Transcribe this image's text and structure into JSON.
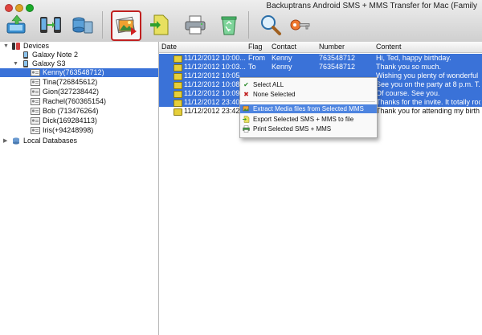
{
  "window": {
    "title": "Backuptrans Android SMS + MMS Transfer for Mac (Family"
  },
  "toolbar": {
    "buttons": [
      {
        "icon": "backup-to-computer-icon"
      },
      {
        "icon": "transfer-between-phones-icon"
      },
      {
        "icon": "restore-database-icon"
      },
      {
        "icon": "extract-media-icon",
        "selected": true
      },
      {
        "icon": "export-file-icon"
      },
      {
        "icon": "print-icon"
      },
      {
        "icon": "recycle-bin-icon"
      },
      {
        "icon": "search-icon"
      },
      {
        "icon": "key-icon"
      }
    ]
  },
  "sidebar": {
    "devices_label": "Devices",
    "device1": "Galaxy Note 2",
    "device2": "Galaxy S3",
    "contacts": [
      "Kenny(763548712)",
      "Tina(726845612)",
      "Gion(327238442)",
      "Rachel(760365154)",
      "Bob (713476264)",
      "Dick(169284113)",
      "Iris(+94248998)"
    ],
    "local_label": "Local Databases"
  },
  "table": {
    "headers": {
      "date": "Date",
      "flag": "Flag",
      "contact": "Contact",
      "number": "Number",
      "content": "Content"
    },
    "rows": [
      {
        "date": "11/12/2012 10:00...",
        "flag": "From",
        "contact": "Kenny",
        "number": "763548712",
        "content": "Hi, Ted, happy birthday."
      },
      {
        "date": "11/12/2012 10:03...",
        "flag": "To",
        "contact": "Kenny",
        "number": "763548712",
        "content": "Thank you so much."
      },
      {
        "date": "11/12/2012 10:05",
        "flag": "",
        "contact": "",
        "number": "",
        "content": "Wishing you plenty of wonderful ..."
      },
      {
        "date": "11/12/2012 10:08",
        "flag": "",
        "contact": "",
        "number": "",
        "content": "See you on the party at 8 p.m. T..."
      },
      {
        "date": "11/12/2012 10:09",
        "flag": "",
        "contact": "",
        "number": "",
        "content": "Of course. See you."
      },
      {
        "date": "11/12/2012 23:40",
        "flag": "",
        "contact": "",
        "number": "",
        "content": "Thanks for the invite. It totally roc..."
      },
      {
        "date": "11/12/2012 23:42",
        "flag": "",
        "contact": "",
        "number": "",
        "content": "Thank you for attending my birth..."
      }
    ]
  },
  "context_menu": {
    "select_all": "Select ALL",
    "none_selected": "None Selected",
    "extract_media": "Extract Media files from Selected MMS",
    "export_file": "Export Selected SMS + MMS to file",
    "print": "Print Selected SMS + MMS"
  },
  "colors": {
    "selection": "#3a72d8",
    "menu_highlight": "#4d84e0",
    "toolbar_selected_border": "#c02020"
  }
}
